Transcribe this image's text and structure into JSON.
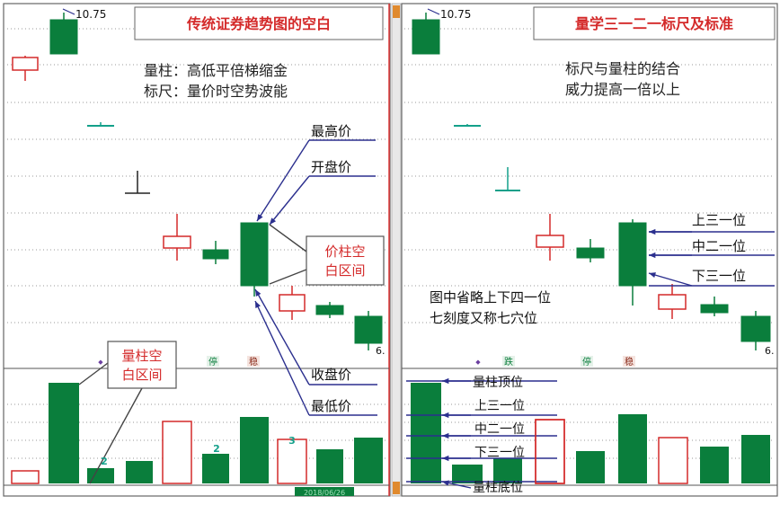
{
  "left": {
    "price_label": "10.75",
    "title": "传统证券趋势图的空白",
    "subtitle_line1": "量柱：高低平倍梯缩金",
    "subtitle_line2": "标尺：量价时空势波能",
    "callouts": {
      "high": "最高价",
      "open": "开盘价",
      "close": "收盘价",
      "low": "最低价",
      "price_gap": [
        "价柱空",
        "白区间"
      ],
      "volume_gap": [
        "量柱空",
        "白区间"
      ]
    },
    "end_label": "6.",
    "vol_digits": [
      "2",
      "2",
      "3"
    ],
    "markers": [
      "◆",
      "停",
      "稳"
    ],
    "date_label": "2018/06/26"
  },
  "right": {
    "price_label": "10.75",
    "title": "量学三一二一标尺及标准",
    "subtitle_line1": "标尺与量柱的结合",
    "subtitle_line2": "威力提高一倍以上",
    "ruler_labels": [
      "上三一位",
      "中二一位",
      "下三一位"
    ],
    "note_line1": "图中省略上下四一位",
    "note_line2": "七刻度又称七穴位",
    "volume_labels": [
      "量柱顶位",
      "上三一位",
      "中二一位",
      "下三一位",
      "量柱底位"
    ],
    "end_label": "6.",
    "markers": [
      "◆",
      "跌",
      "停",
      "稳"
    ]
  },
  "colors": {
    "up": "#d42a2a",
    "down": "#0a7e3c",
    "teal": "#13a08a",
    "arrow": "#2b2f8e",
    "frame": "#d33333",
    "grid": "#9a9a9a"
  }
}
